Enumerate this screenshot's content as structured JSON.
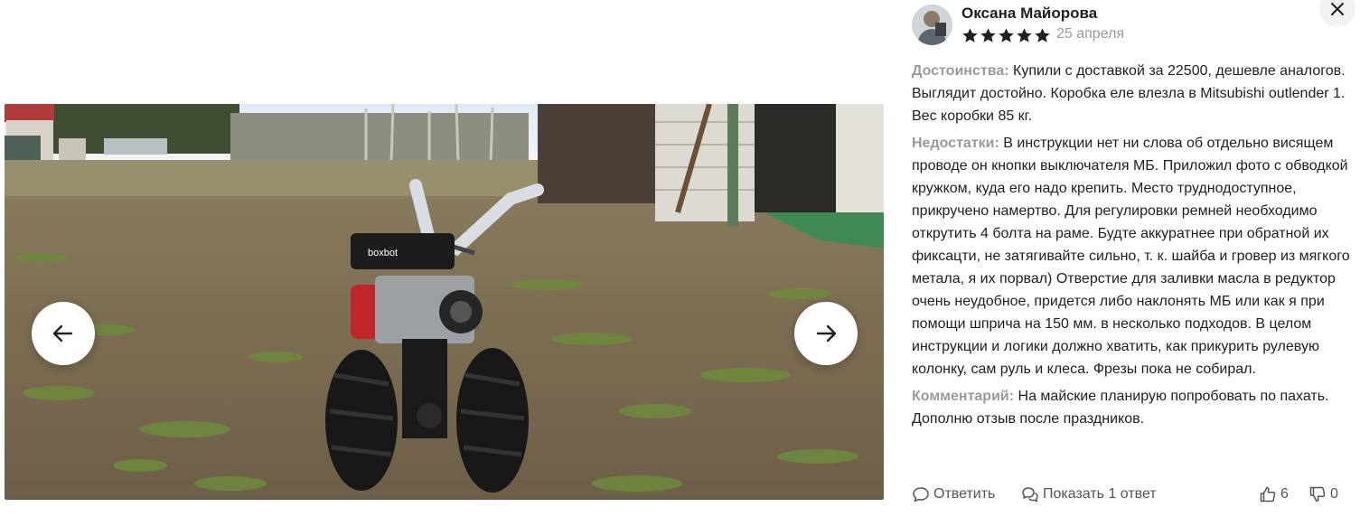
{
  "viewer": {
    "image_description_icon": "photo-tiller",
    "prev_icon": "arrow-left-icon",
    "next_icon": "arrow-right-icon",
    "engine_brand": "boxbot"
  },
  "review": {
    "author": "Оксана Майорова",
    "stars": 5,
    "date": "25 апреля",
    "pros_label": "Достоинства:",
    "pros_text": "Купили с доставкой за 22500, дешевле аналогов. Выглядит достойно. Коробка еле влезла в Mitsubishi outlender 1. Вес коробки 85 кг.",
    "cons_label": "Недостатки:",
    "cons_text": "В инструкции нет ни слова об отдельно висящем проводе он кнопки выключателя МБ. Приложил фото с обводкой кружком, куда его надо крепить. Место труднодоступное, прикручено намертво. Для регулировки ремней необходимо открутить 4 болта на раме. Будте аккуратнее при обратной их фиксацти, не затягивайте сильно, т. к. шайба и гровер из мягкого метала, я их порвал) Отверстие для заливки масла в редуктор очень неудобное, придется либо наклонять МБ или как я при помощи шприча на 150 мм. в несколько подходов. В целом инструкции и логики должно хватить, как прикурить рулевую колонку, сам руль и клеса. Фрезы пока не собирал.",
    "comment_label": "Комментарий:",
    "comment_text": "На майские планирую попробовать по пахать. Дополню отзыв после праздников."
  },
  "actions": {
    "reply": "Ответить",
    "show_answers": "Показать 1 ответ",
    "likes": "6",
    "dislikes": "0"
  },
  "colors": {
    "star": "#21201f",
    "label": "#9a9a9a",
    "muted": "#999999"
  }
}
